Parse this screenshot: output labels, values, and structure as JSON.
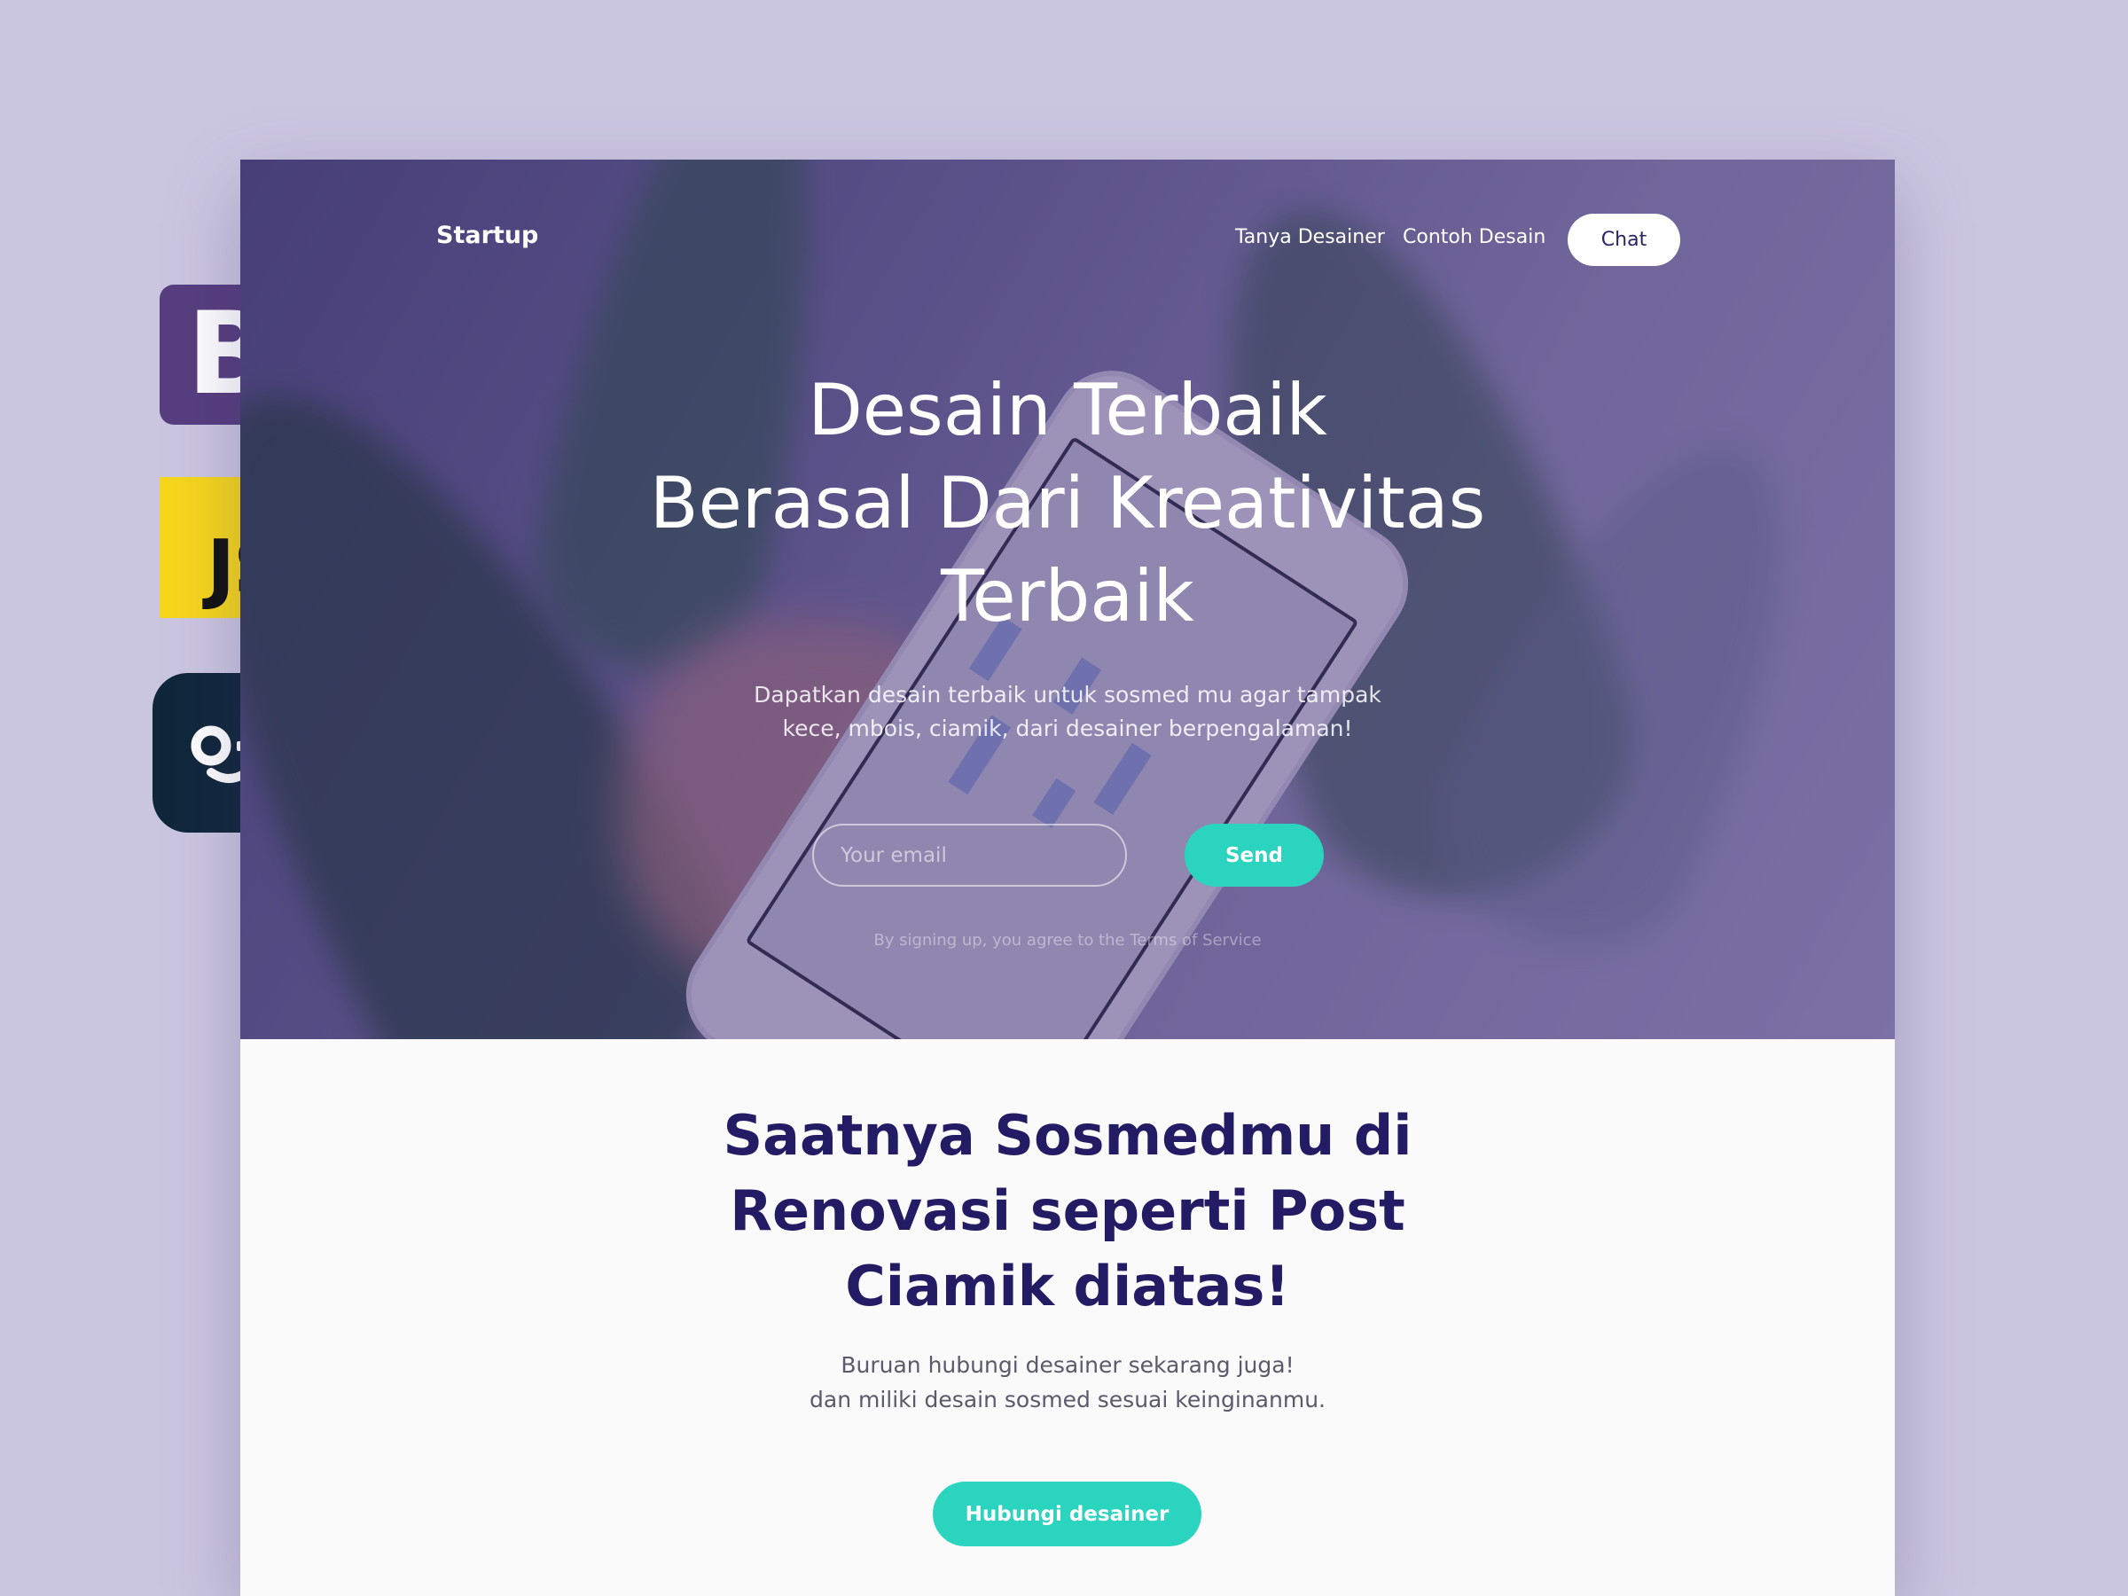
{
  "badges": {
    "bootstrap_letter": "B",
    "js_text": "JS"
  },
  "nav": {
    "brand": "Startup",
    "links": [
      "Tanya Desainer",
      "Contoh Desain"
    ],
    "chat_label": "Chat"
  },
  "hero": {
    "title_lines": [
      "Desain Terbaik",
      "Berasal Dari Kreativitas",
      "Terbaik"
    ],
    "subtitle_lines": [
      "Dapatkan desain terbaik untuk sosmed mu agar tampak",
      "kece, mbois, ciamik, dari desainer berpengalaman!"
    ],
    "email_placeholder": "Your email",
    "send_label": "Send",
    "terms": "By signing up, you agree to the Terms of Service"
  },
  "section": {
    "title_lines": [
      "Saatnya Sosmedmu di",
      "Renovasi seperti Post",
      "Ciamik diatas!"
    ],
    "subtitle_lines": [
      "Buruan hubungi desainer sekarang juga!",
      "dan miliki desain sosmed sesuai keinginanmu."
    ],
    "cta_label": "Hubungi desainer"
  },
  "colors": {
    "page_bg": "#cbc6e0",
    "accent": "#2ad4be",
    "heading": "#231b63",
    "bootstrap": "#573e7f",
    "js": "#f7d71c",
    "logo_bg": "#10273b"
  }
}
